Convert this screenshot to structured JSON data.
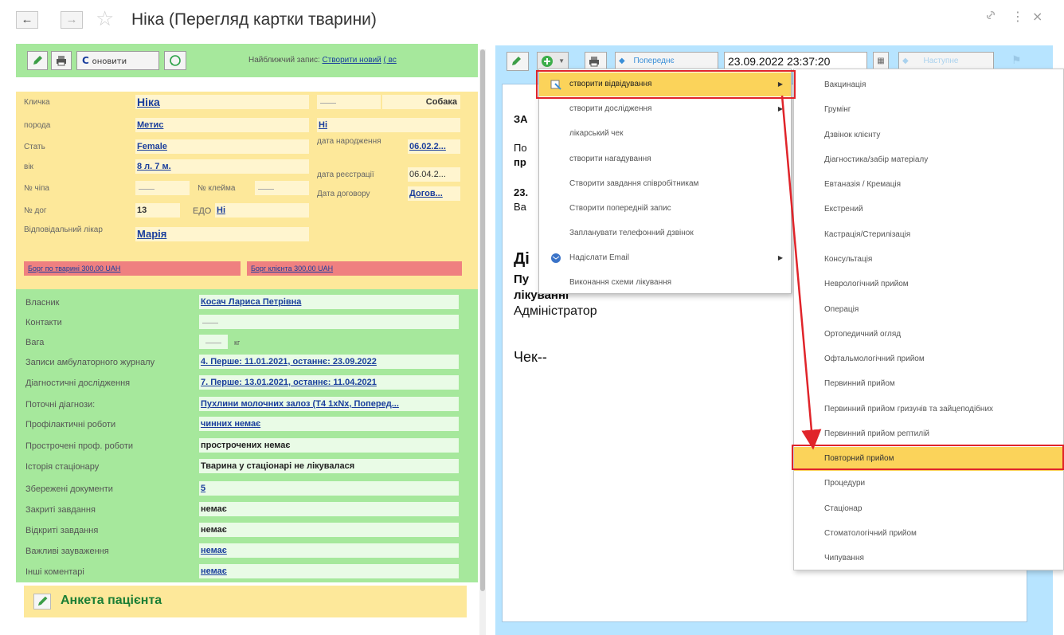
{
  "window": {
    "title": "Ніка (Перегляд картки тварини)",
    "back_icon": "←",
    "forward_icon": "→",
    "star_icon": "☆",
    "link_icon": "🔗",
    "more_icon": "⋮",
    "close_icon": "×"
  },
  "left_toolbar": {
    "refresh_label": "оновити",
    "refresh_prefix": "С",
    "nearest_label": "Найближчий запис:",
    "create_new": "Створити новий",
    "suffix": "( вс"
  },
  "animal": {
    "nickname_label": "Кличка",
    "nickname": "Ніка",
    "species": "Собака",
    "breed_label": "порода",
    "breed": "Метис",
    "breed_extra": "Ні",
    "sex_label": "Стать",
    "sex": "Female",
    "birth_label": "дата народження",
    "birth_date": "06.02.2...",
    "age_label": "вік",
    "age": "8 л. 7 м.",
    "reg_label": "дата реєстрації",
    "reg_date": "06.04.2...",
    "chip_label": "№ чіпа",
    "brand_label": "№ клейма",
    "contract_date_label": "Дата договору",
    "contract_date": "Догов...",
    "contract_label": "№ дог",
    "contract_no": "13",
    "edo_label": "ЕДО",
    "edo": "Ні",
    "doctor_label": "Відповідальний лікар",
    "doctor": "Марія"
  },
  "debts": {
    "animal": "Борг по тварині 300,00 UAH",
    "client": "Борг клієнта 300,00 UAH"
  },
  "owner": {
    "rows": [
      {
        "label": "Власник",
        "value": "Косач Лариса Петрівна"
      },
      {
        "label": "Контакти",
        "value": ""
      },
      {
        "label": "Вага",
        "value": "кг"
      },
      {
        "label": "Записи амбулаторного журналу",
        "value": "4. Перше: 11.01.2021, останнє: 23.09.2022"
      },
      {
        "label": "Діагностичні дослідження",
        "value": "7. Перше: 13.01.2021, останнє: 11.04.2021"
      },
      {
        "label": "Поточні діагнози:",
        "value": "Пухлини молочних залоз (T4 1xNx, Поперед..."
      },
      {
        "label": "Профілактичні роботи",
        "value": "чинних немає"
      },
      {
        "label": "Прострочені проф. роботи",
        "value": "прострочених немає"
      },
      {
        "label": "Історія стаціонару",
        "value": "Тварина у стаціонарі не лікувалася"
      },
      {
        "label": "Збережені документи",
        "value": "5"
      },
      {
        "label": "Закриті завдання",
        "value": "немає"
      },
      {
        "label": "Відкриті завдання",
        "value": "немає"
      },
      {
        "label": "Важливі зауваження",
        "value": "немає"
      },
      {
        "label": "Інші коментарі",
        "value": "немає"
      }
    ]
  },
  "anketa": {
    "title": "Анкета пацієнта"
  },
  "right_toolbar": {
    "prev_label": "Попереднє",
    "datetime": "23.09.2022 23:37:20",
    "next_label": "Наступне"
  },
  "paper": {
    "line_za": "ЗА",
    "line_po": "По",
    "line_pr": "пр",
    "line_23": "23.",
    "line_va": "Ва",
    "line_di": "Ді",
    "line_pu": "Пу",
    "line_treat": "лікуванні",
    "line_admin": "Адміністратор",
    "line_check": "Чек--"
  },
  "menu": {
    "items": [
      {
        "label": "створити відвідування",
        "submenu": true
      },
      {
        "label": "створити дослідження",
        "submenu": true
      },
      {
        "label": "лікарський чек",
        "submenu": false
      },
      {
        "label": "створити нагадування",
        "submenu": false
      },
      {
        "label": "Створити завдання співробітникам",
        "submenu": false
      },
      {
        "label": "Створити попередній запис",
        "submenu": false
      },
      {
        "label": "Запланувати телефонний дзвінок",
        "submenu": false
      },
      {
        "label": "Надіслати Email",
        "submenu": true
      },
      {
        "label": "Виконання схеми лікування",
        "submenu": false
      }
    ]
  },
  "submenu": {
    "items": [
      "Вакцинація",
      "Грумінг",
      "Дзвінок клієнту",
      "Діагностика/забір матеріалу",
      "Евтаназія / Кремація",
      "Екстрений",
      "Кастрація/Стерилізація",
      "Консультація",
      "Неврологічний прийом",
      "Операція",
      "Ортопедичний огляд",
      "Офтальмологічний прийом",
      "Первинний прийом",
      "Первинний прийом гризунів та зайцеподібних",
      "Первинний прийом рептилій",
      "Повторний прийом",
      "Процедури",
      "Стаціонар",
      "Стоматологічний прийом",
      "Чипування"
    ]
  },
  "colors": {
    "green_panel": "#a6e89c",
    "yellow_panel": "#fde89a",
    "blue_panel": "#b7e4ff",
    "highlight": "#fbd35a",
    "annotation_red": "#e0242a",
    "debt_red": "#ef8080"
  }
}
